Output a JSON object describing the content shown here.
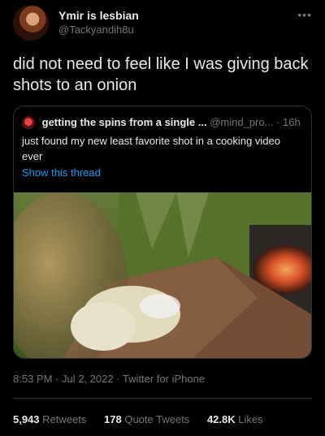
{
  "author": {
    "display_name": "Ymir is lesbian",
    "handle": "@Tackyandih8u",
    "more_icon": "ellipsis-icon"
  },
  "tweet": {
    "text": "did not need to feel like I was giving back shots to an onion"
  },
  "quoted": {
    "display_name": "getting the spins from a single ...",
    "handle": "@mind_pro...",
    "time": "· 16h",
    "text": "just found my new least favorite shot in a cooking video ever",
    "show_thread": "Show this thread",
    "media_icon": "video-still-image"
  },
  "meta": {
    "timestamp": "8:53 PM · Jul 2, 2022 · Twitter for iPhone"
  },
  "stats": {
    "retweets_count": "5,943",
    "retweets_label": "Retweets",
    "quotes_count": "178",
    "quotes_label": "Quote Tweets",
    "likes_count": "42.8K",
    "likes_label": "Likes"
  },
  "colors": {
    "background": "#000000",
    "text": "#e7e9ea",
    "muted": "#71767b",
    "link": "#1d9bf0",
    "border": "#2f3336"
  }
}
